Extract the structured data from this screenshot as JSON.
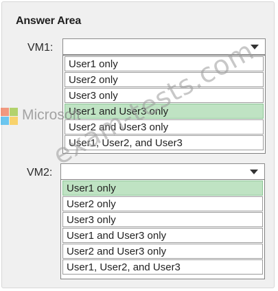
{
  "answer_area": {
    "title": "Answer Area"
  },
  "vm1": {
    "label": "VM1:",
    "selected_value": "",
    "options": [
      {
        "label": "User1 only",
        "selected": false
      },
      {
        "label": "User2 only",
        "selected": false
      },
      {
        "label": "User3 only",
        "selected": false
      },
      {
        "label": "User1 and User3 only",
        "selected": true
      },
      {
        "label": "User2 and User3 only",
        "selected": false
      },
      {
        "label": "User1, User2, and User3",
        "selected": false
      }
    ]
  },
  "vm2": {
    "label": "VM2:",
    "selected_value": "",
    "options": [
      {
        "label": "User1 only",
        "selected": true
      },
      {
        "label": "User2 only",
        "selected": false
      },
      {
        "label": "User3 only",
        "selected": false
      },
      {
        "label": "User1 and User3 only",
        "selected": false
      },
      {
        "label": "User2 and User3 only",
        "selected": false
      },
      {
        "label": "User1, User2, and User3",
        "selected": false
      }
    ]
  },
  "overlays": {
    "microsoft_text": "Microsoft",
    "watermark": "exam-tests.com"
  },
  "colors": {
    "selected_option": "#bfe3c3",
    "panel_background": "#f0f0f0",
    "logo_red": "#f25022",
    "logo_green": "#7fba00",
    "logo_blue": "#00a4ef",
    "logo_yellow": "#ffb900"
  }
}
